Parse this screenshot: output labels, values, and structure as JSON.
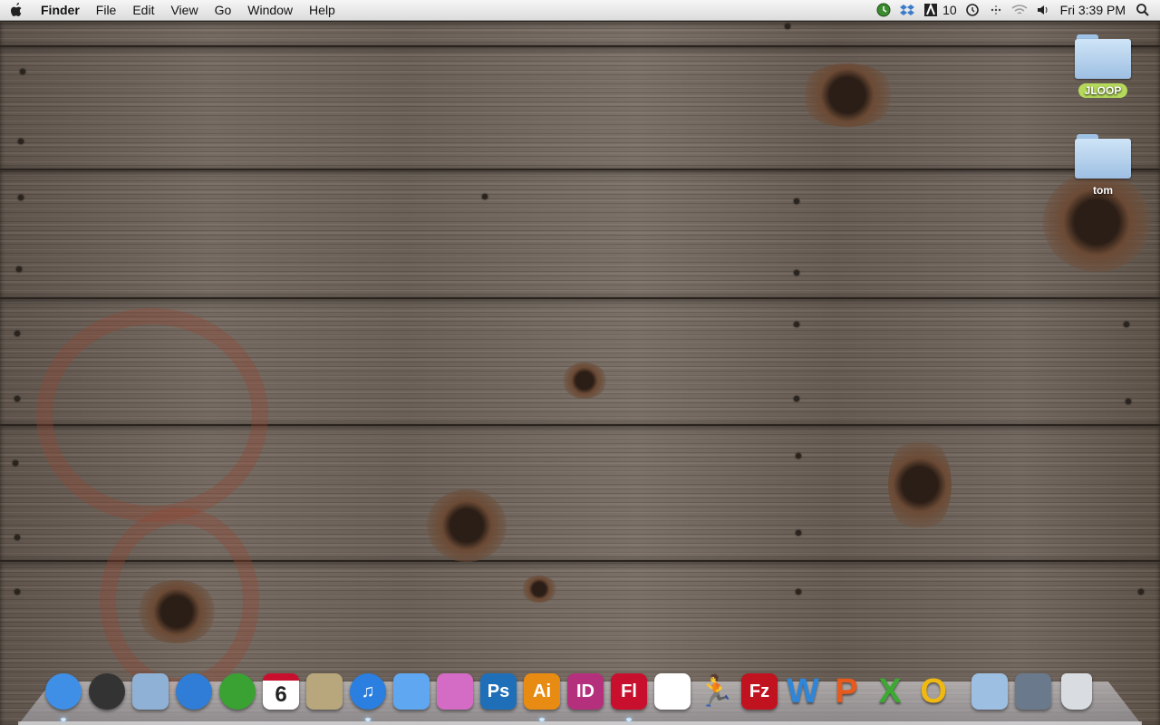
{
  "menubar": {
    "app_name": "Finder",
    "menus": [
      "File",
      "Edit",
      "View",
      "Go",
      "Window",
      "Help"
    ],
    "status_badge": "10",
    "clock": "Fri 3:39 PM"
  },
  "desktop": {
    "items": [
      {
        "label": "JLOOP",
        "tag_color": "#b5d95a"
      },
      {
        "label": "tom"
      }
    ]
  },
  "dock": {
    "apps": [
      {
        "name": "finder-icon",
        "text": "",
        "color": "#3f8fe6"
      },
      {
        "name": "dashboard-icon",
        "text": "",
        "color": "#333333"
      },
      {
        "name": "mail-icon",
        "text": "",
        "color": "#8fb1d6"
      },
      {
        "name": "safari-icon",
        "text": "",
        "color": "#2f7dd6"
      },
      {
        "name": "green-app-icon",
        "text": "",
        "color": "#3aa232"
      },
      {
        "name": "ical-icon",
        "text": "6",
        "color": "#ffffff"
      },
      {
        "name": "preview-icon",
        "text": "",
        "color": "#b8a67c"
      },
      {
        "name": "itunes-icon",
        "text": "♫",
        "color": "#2a7fe0"
      },
      {
        "name": "ichat-icon",
        "text": "",
        "color": "#5fa7f0"
      },
      {
        "name": "rings-app-icon",
        "text": "",
        "color": "#d46bc5"
      },
      {
        "name": "photoshop-icon",
        "text": "Ps",
        "color": "#1f6fb8"
      },
      {
        "name": "illustrator-icon",
        "text": "Ai",
        "color": "#e88b12"
      },
      {
        "name": "indesign-icon",
        "text": "ID",
        "color": "#b5307c"
      },
      {
        "name": "flash-icon",
        "text": "Fl",
        "color": "#c8102e"
      },
      {
        "name": "acrobat-icon",
        "text": "",
        "color": "#ffffff"
      },
      {
        "name": "aim-icon",
        "text": "",
        "color": "#f5d20f"
      },
      {
        "name": "filezilla-icon",
        "text": "Fz",
        "color": "#c1121f"
      },
      {
        "name": "word-icon",
        "text": "W",
        "color": "#2f86d9"
      },
      {
        "name": "powerpoint-icon",
        "text": "P",
        "color": "#e85a1b"
      },
      {
        "name": "excel-icon",
        "text": "X",
        "color": "#3caa32"
      },
      {
        "name": "outlook-icon",
        "text": "O",
        "color": "#f0b912"
      }
    ],
    "folders": [
      {
        "name": "applications-folder-icon",
        "color": "#9dbfe2"
      },
      {
        "name": "downloads-stack-icon",
        "color": "#6a7a8c"
      },
      {
        "name": "trash-icon",
        "color": "#d9dde2"
      }
    ]
  }
}
